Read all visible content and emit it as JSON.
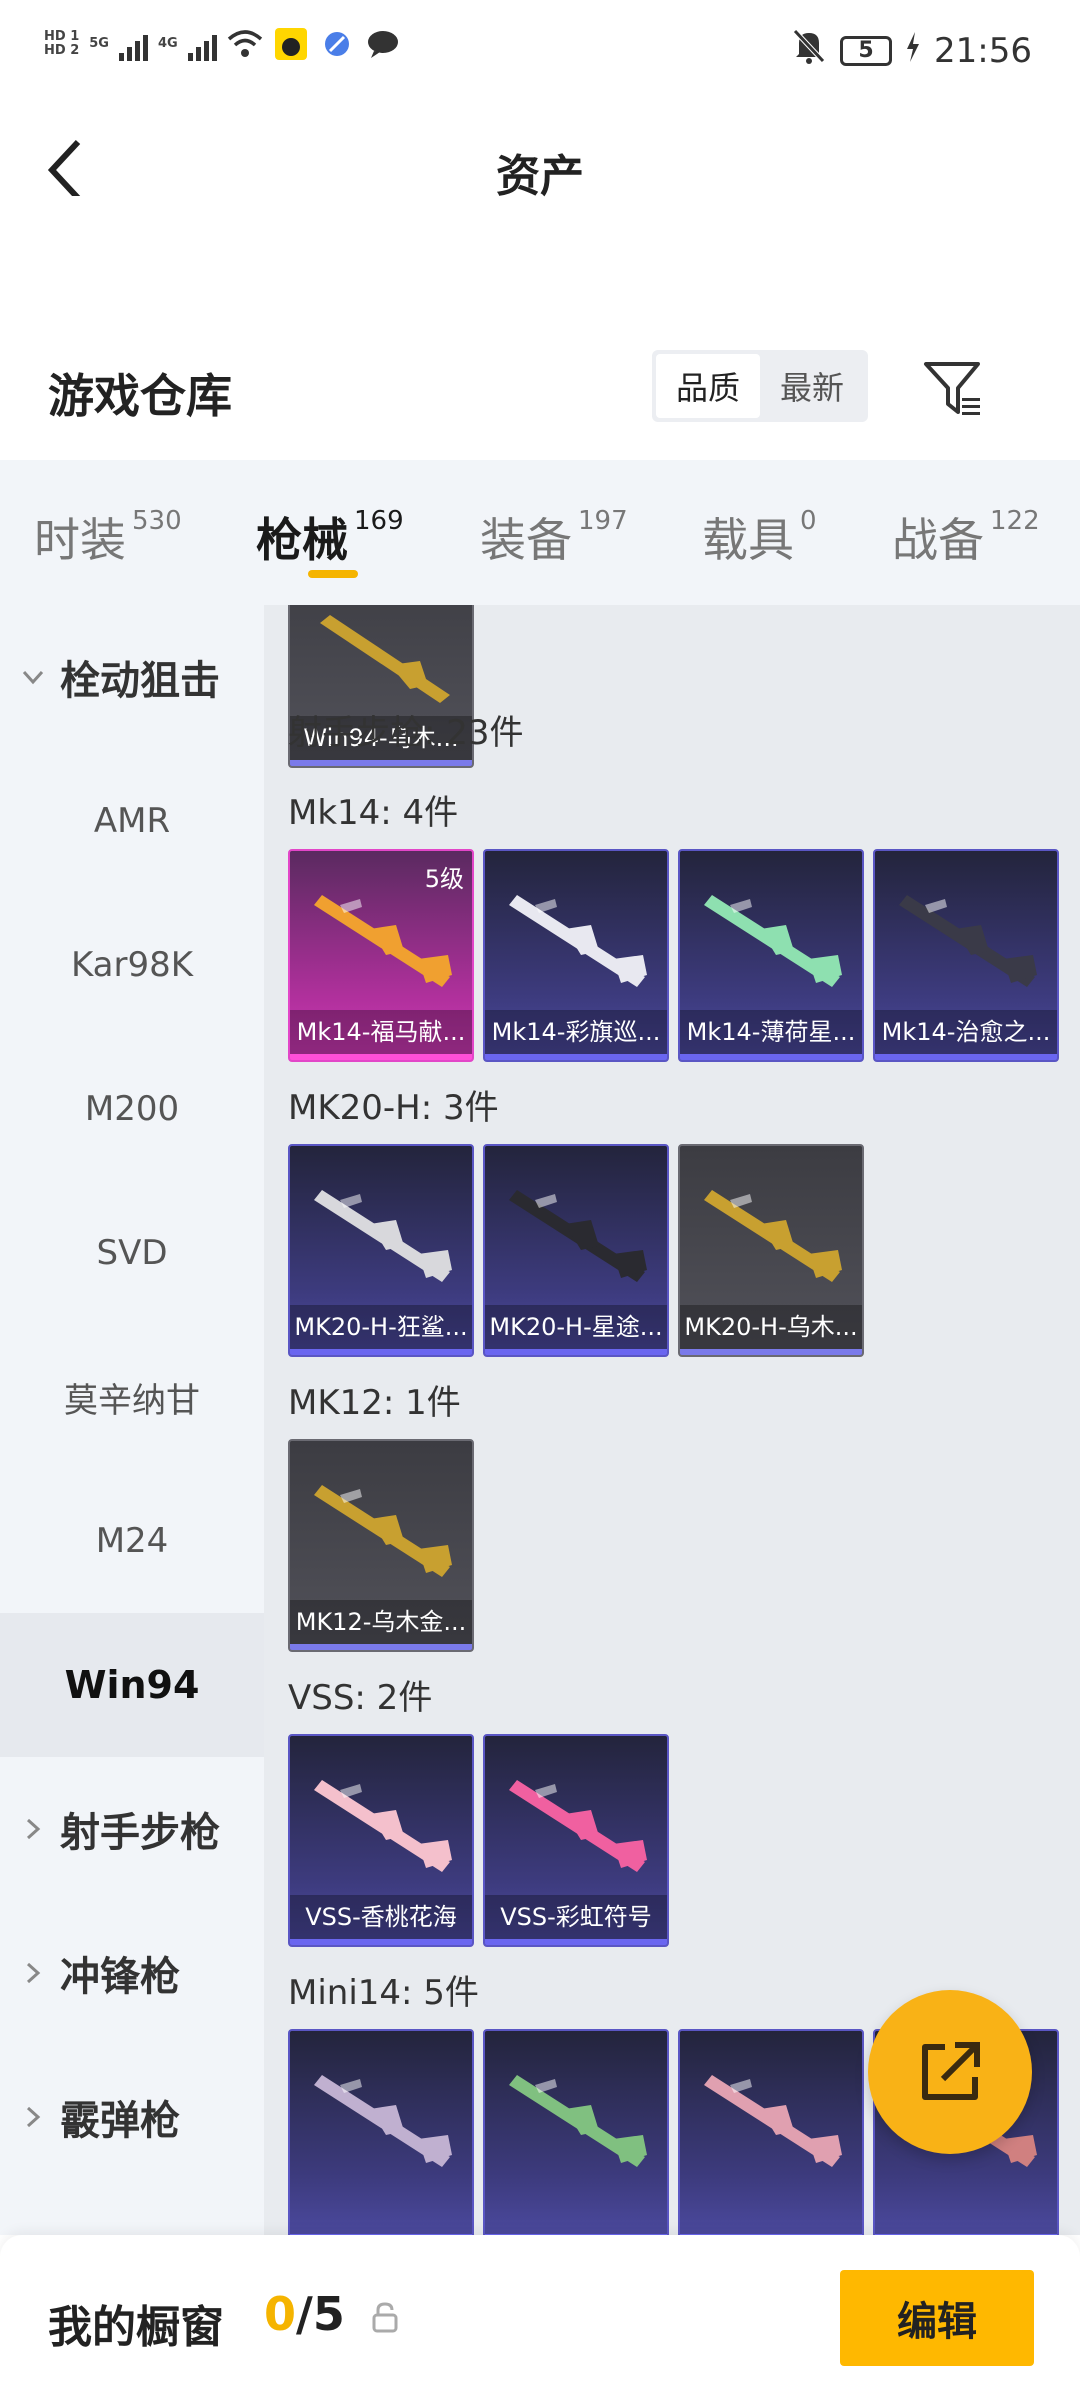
{
  "status": {
    "hd1": "HD 1",
    "hd2": "HD 2",
    "net1": "5G",
    "net2": "4G",
    "battery": "5",
    "time": "21:56"
  },
  "header": {
    "title": "资产"
  },
  "warehouse": {
    "title": "游戏仓库",
    "sort": [
      "品质",
      "最新"
    ],
    "active_sort": "品质"
  },
  "tabs": [
    {
      "label": "时装",
      "count": "530"
    },
    {
      "label": "枪械",
      "count": "169"
    },
    {
      "label": "装备",
      "count": "197"
    },
    {
      "label": "载具",
      "count": "0"
    },
    {
      "label": "战备",
      "count": "122"
    }
  ],
  "sidebar": {
    "category_open": "栓动狙击",
    "subs": [
      "AMR",
      "Kar98K",
      "M200",
      "SVD",
      "莫辛纳甘",
      "M24",
      "Win94"
    ],
    "active_sub": "Win94",
    "categories_closed": [
      "射手步枪",
      "冲锋枪",
      "霰弹枪"
    ]
  },
  "content": {
    "top_card": {
      "name": "Win94-乌木...",
      "style": "gold"
    },
    "marksman_title": "射手步枪: 23件",
    "groups": [
      {
        "title": "Mk14: 4件",
        "items": [
          {
            "name": "Mk14-福马献...",
            "style": "pink",
            "level": "5级",
            "color": "#f0a030"
          },
          {
            "name": "Mk14-彩旗巡...",
            "style": "purple",
            "color": "#e8e8f0"
          },
          {
            "name": "Mk14-薄荷星...",
            "style": "purple",
            "color": "#8ee0b0"
          },
          {
            "name": "Mk14-治愈之...",
            "style": "purple",
            "color": "#3a3a48"
          }
        ]
      },
      {
        "title": "MK20-H: 3件",
        "items": [
          {
            "name": "MK20-H-狂鲨...",
            "style": "purple",
            "color": "#d8d8dc"
          },
          {
            "name": "MK20-H-星途...",
            "style": "purple",
            "color": "#2a2a30"
          },
          {
            "name": "MK20-H-乌木...",
            "style": "gold",
            "color": "#c8a030"
          }
        ]
      },
      {
        "title": "MK12: 1件",
        "items": [
          {
            "name": "MK12-乌木金...",
            "style": "gold",
            "color": "#c8a030"
          }
        ]
      },
      {
        "title": "VSS: 2件",
        "items": [
          {
            "name": "VSS-香桃花海",
            "style": "purple",
            "color": "#f4c0cc"
          },
          {
            "name": "VSS-彩虹符号",
            "style": "purple",
            "color": "#f060a0"
          }
        ]
      },
      {
        "title": "Mini14: 5件",
        "items": [
          {
            "name": "",
            "style": "purple",
            "color": "#c0b0d0"
          },
          {
            "name": "",
            "style": "purple",
            "color": "#80c080"
          },
          {
            "name": "",
            "style": "purple",
            "color": "#e0a0b0"
          },
          {
            "name": "",
            "style": "purple",
            "color": "#d08080"
          }
        ]
      }
    ]
  },
  "bottom": {
    "label": "我的橱窗",
    "current": "0",
    "max": "5",
    "edit": "编辑"
  }
}
